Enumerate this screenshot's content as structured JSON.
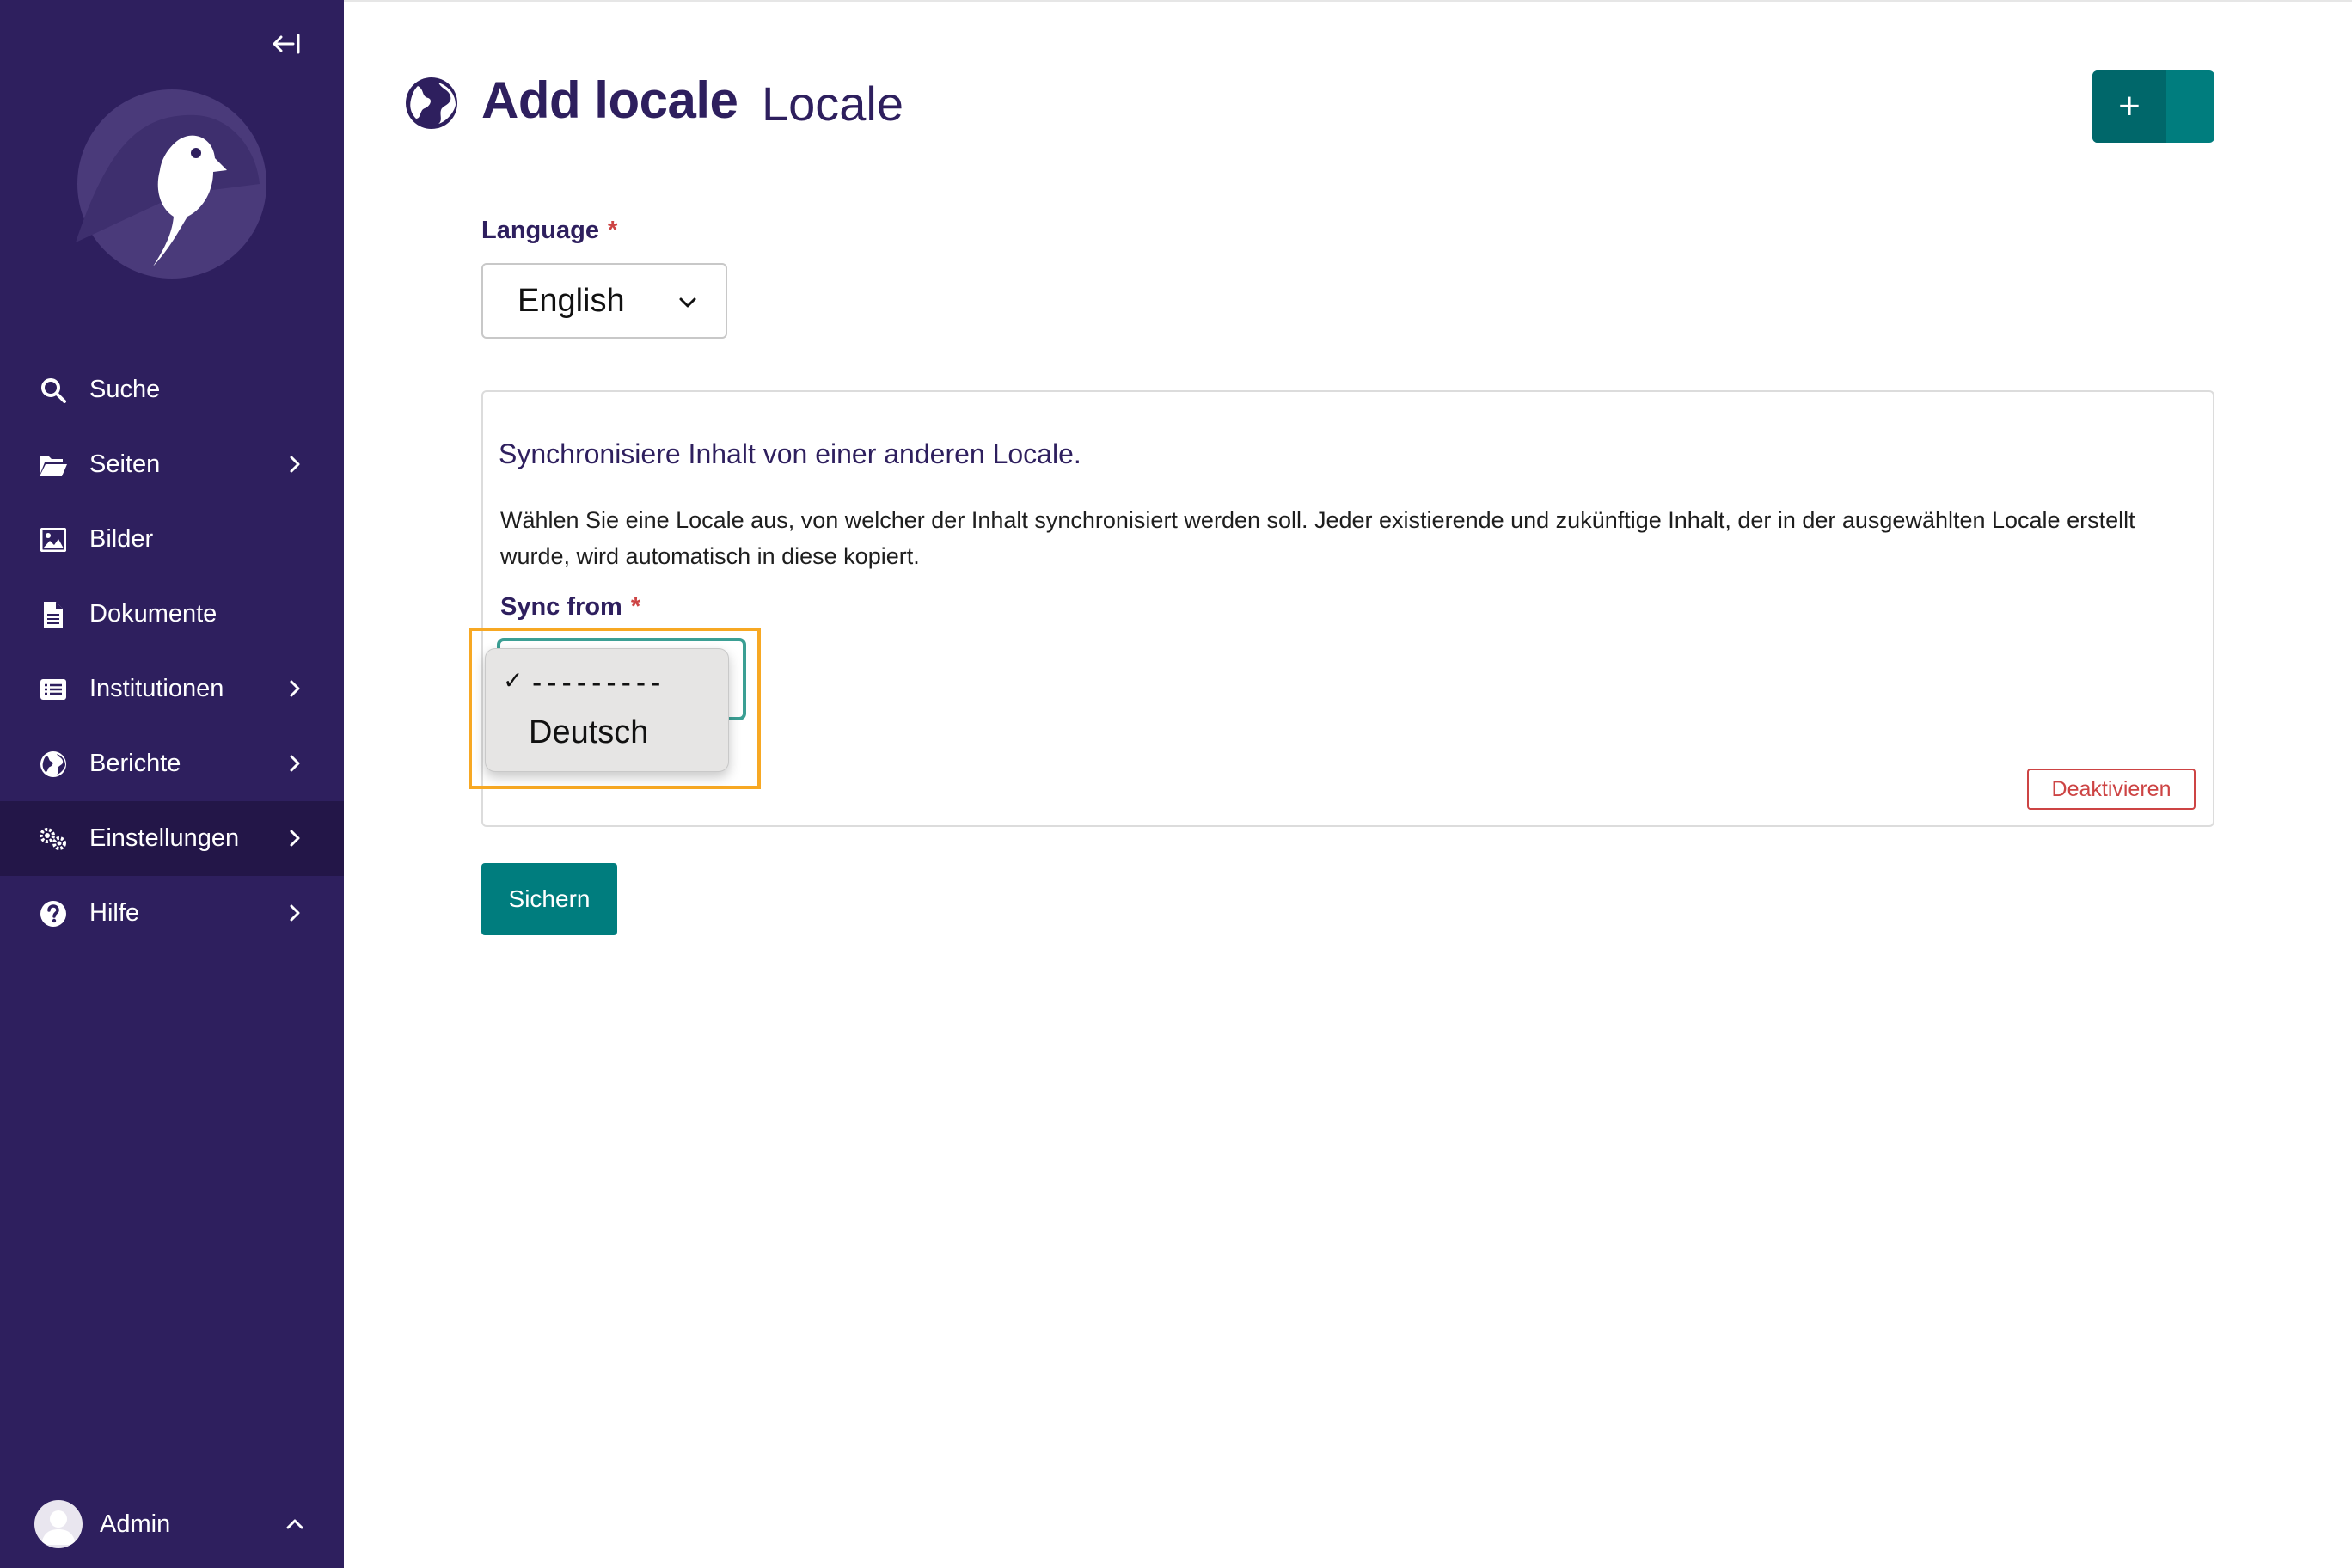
{
  "sidebar": {
    "collapse_icon": "collapse-left-icon",
    "logo_icon": "wagtail-bird-logo",
    "items": [
      {
        "label": "Suche",
        "icon": "search-icon",
        "has_chevron": false
      },
      {
        "label": "Seiten",
        "icon": "folder-open-icon",
        "has_chevron": true
      },
      {
        "label": "Bilder",
        "icon": "image-icon",
        "has_chevron": false
      },
      {
        "label": "Dokumente",
        "icon": "document-icon",
        "has_chevron": false
      },
      {
        "label": "Institutionen",
        "icon": "list-icon",
        "has_chevron": true
      },
      {
        "label": "Berichte",
        "icon": "globe-icon",
        "has_chevron": true
      },
      {
        "label": "Einstellungen",
        "icon": "cogs-icon",
        "has_chevron": true,
        "active": true
      },
      {
        "label": "Hilfe",
        "icon": "help-icon",
        "has_chevron": true
      }
    ],
    "user": {
      "label": "Admin",
      "icon": "avatar",
      "chevron": "chevron-up-icon"
    }
  },
  "header": {
    "icon": "globe-icon",
    "title": "Add locale",
    "subtitle": "Locale",
    "add_button_label": "+"
  },
  "form": {
    "language_label": "Language",
    "required_mark": "*",
    "language_value": "English",
    "sync_panel": {
      "heading": "Synchronisiere Inhalt von einer anderen Locale.",
      "description": "Wählen Sie eine Locale aus, von welcher der Inhalt synchronisiert werden soll. Jeder existierende und zukünftige Inhalt, der in der ausgewählten Locale erstellt wurde, wird automatisch in diese kopiert.",
      "sync_from_label": "Sync from",
      "options": [
        {
          "label": "---------",
          "selected": true
        },
        {
          "label": "Deutsch",
          "selected": false
        }
      ],
      "check_mark": "✓",
      "deactivate_label": "Deaktivieren"
    },
    "save_label": "Sichern"
  },
  "colors": {
    "sidebar_bg": "#2e1f5e",
    "sidebar_active_bg": "#231648",
    "primary_teal": "#007d7e",
    "danger_red": "#cd4444",
    "highlight_orange": "#f7a823",
    "heading_purple": "#2e1f5e"
  }
}
